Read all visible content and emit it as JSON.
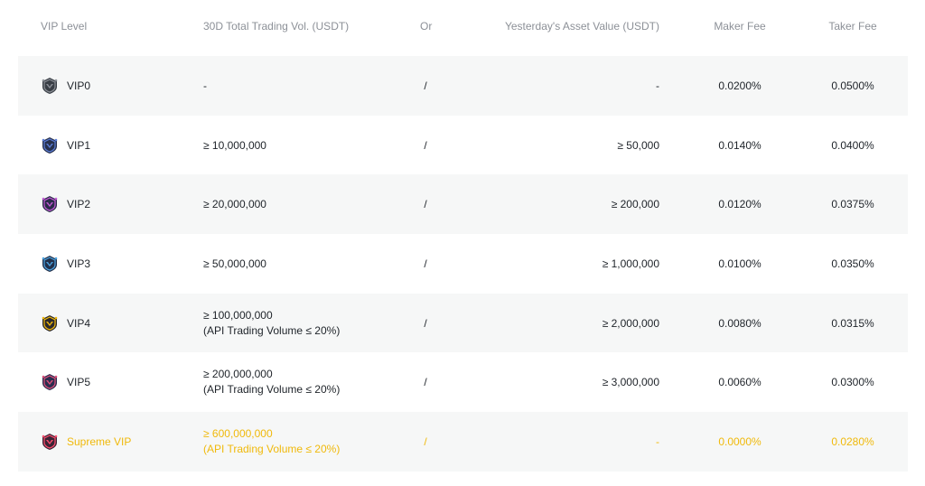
{
  "headers": {
    "vip_level": "VIP Level",
    "trading_vol": "30D Total Trading Vol. (USDT)",
    "or": "Or",
    "asset_value": "Yesterday's Asset Value (USDT)",
    "maker_fee": "Maker Fee",
    "taker_fee": "Taker Fee"
  },
  "rows": [
    {
      "level": "VIP0",
      "vol": "-",
      "vol_note": "",
      "or": "/",
      "asset": "-",
      "maker": "0.0200%",
      "taker": "0.0500%",
      "badge_color": "#3a3f46",
      "badge_accent": "#8c9097"
    },
    {
      "level": "VIP1",
      "vol": "≥ 10,000,000",
      "vol_note": "",
      "or": "/",
      "asset": "≥ 50,000",
      "maker": "0.0140%",
      "taker": "0.0400%",
      "badge_color": "#26304d",
      "badge_accent": "#5b7cd6"
    },
    {
      "level": "VIP2",
      "vol": "≥ 20,000,000",
      "vol_note": "",
      "or": "/",
      "asset": "≥ 200,000",
      "maker": "0.0120%",
      "taker": "0.0375%",
      "badge_color": "#2b2a4a",
      "badge_accent": "#c45bd6"
    },
    {
      "level": "VIP3",
      "vol": "≥ 50,000,000",
      "vol_note": "",
      "or": "/",
      "asset": "≥ 1,000,000",
      "maker": "0.0100%",
      "taker": "0.0350%",
      "badge_color": "#22304a",
      "badge_accent": "#4ca3e0"
    },
    {
      "level": "VIP4",
      "vol": "≥ 100,000,000",
      "vol_note": "(API Trading Volume ≤ 20%)",
      "or": "/",
      "asset": "≥ 2,000,000",
      "maker": "0.0080%",
      "taker": "0.0315%",
      "badge_color": "#2d2a2a",
      "badge_accent": "#f0b90b"
    },
    {
      "level": "VIP5",
      "vol": "≥ 200,000,000",
      "vol_note": "(API Trading Volume ≤ 20%)",
      "or": "/",
      "asset": "≥ 3,000,000",
      "maker": "0.0060%",
      "taker": "0.0300%",
      "badge_color": "#2a2d4f",
      "badge_accent": "#e0507a"
    },
    {
      "level": "Supreme VIP",
      "vol": "≥ 600,000,000",
      "vol_note": "(API Trading Volume ≤ 20%)",
      "or": "/",
      "asset": "-",
      "maker": "0.0000%",
      "taker": "0.0280%",
      "badge_color": "#3a2435",
      "badge_accent": "#ff4d6d"
    }
  ],
  "colors": {
    "header_text": "#8c9097",
    "body_text": "#1e2329",
    "row_shade": "#f6f7f7",
    "supreme_text": "#f0b90b"
  },
  "icons": [
    "vip0-badge-icon",
    "vip1-badge-icon",
    "vip2-badge-icon",
    "vip3-badge-icon",
    "vip4-badge-icon",
    "vip5-badge-icon",
    "supreme-vip-badge-icon"
  ]
}
